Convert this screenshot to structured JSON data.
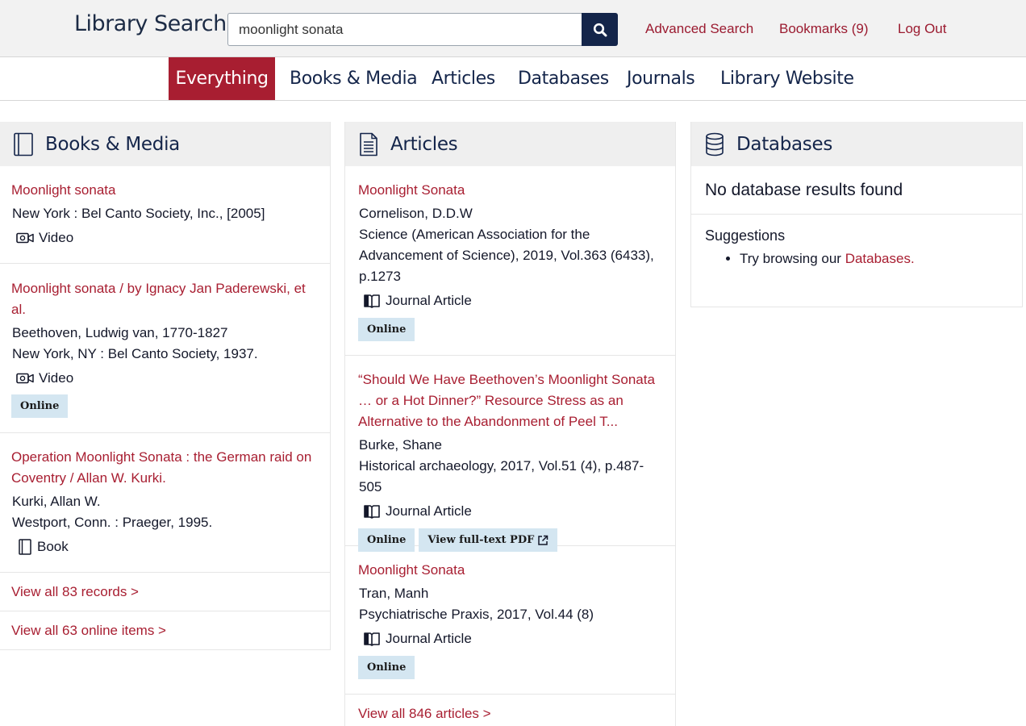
{
  "header": {
    "brand": "Library Search",
    "search": {
      "value": "moonlight sonata",
      "button_icon": "search-icon"
    },
    "links": [
      {
        "label": "Advanced Search"
      },
      {
        "label": "Bookmarks (9)"
      },
      {
        "label": "Log Out"
      }
    ]
  },
  "nav": {
    "tabs": [
      {
        "label": "Everything",
        "active": true
      },
      {
        "label": "Books & Media"
      },
      {
        "label": "Articles"
      },
      {
        "label": "Databases"
      },
      {
        "label": "Journals"
      },
      {
        "label": "Library Website"
      }
    ]
  },
  "books": {
    "title": "Books & Media",
    "icon": "book-icon",
    "results": [
      {
        "title": "Moonlight sonata",
        "lines": [
          "New York : Bel Canto Society, Inc., [2005]"
        ],
        "type": "Video",
        "badges": []
      },
      {
        "title": "Moonlight sonata / by Ignacy Jan Paderewski, et al.",
        "lines": [
          "Beethoven, Ludwig van, 1770-1827",
          "New York, NY : Bel Canto Society, 1937."
        ],
        "type": "Video",
        "badges": [
          "Online"
        ]
      },
      {
        "title": "Operation Moonlight Sonata : the German raid on Coventry / Allan W. Kurki.",
        "lines": [
          "Kurki, Allan W.",
          "Westport, Conn. : Praeger, 1995."
        ],
        "type": "Book",
        "badges": []
      }
    ],
    "view_all_records": "View all 83 records >",
    "view_all_online": "View all 63 online items >"
  },
  "articles": {
    "title": "Articles",
    "icon": "document-icon",
    "results": [
      {
        "title": "Moonlight Sonata",
        "lines": [
          "Cornelison, D.D.W",
          "Science (American Association for the Advancement of Science), 2019, Vol.363 (6433), p.1273"
        ],
        "type": "Journal Article",
        "badges": [
          "Online"
        ]
      },
      {
        "title": "“Should We Have Beethoven’s Moonlight Sonata … or a Hot Dinner?” Resource Stress as an Alternative to the Abandonment of Peel T...",
        "lines": [
          "Burke, Shane",
          "Historical archaeology, 2017, Vol.51 (4), p.487-505"
        ],
        "type": "Journal Article",
        "badges": [
          "Online",
          "View full-text PDF"
        ]
      },
      {
        "title": "Moonlight Sonata",
        "lines": [
          "Tran, Manh",
          "Psychiatrische Praxis, 2017, Vol.44 (8)"
        ],
        "type": "Journal Article",
        "badges": [
          "Online"
        ]
      }
    ],
    "view_all": "View all 846 articles >"
  },
  "databases": {
    "title": "Databases",
    "icon": "database-icon",
    "no_results": "No database results found",
    "suggestions_title": "Suggestions",
    "suggestion_prefix": "Try browsing our ",
    "suggestion_link": "Databases.",
    "suggestion_suffix": ""
  }
}
